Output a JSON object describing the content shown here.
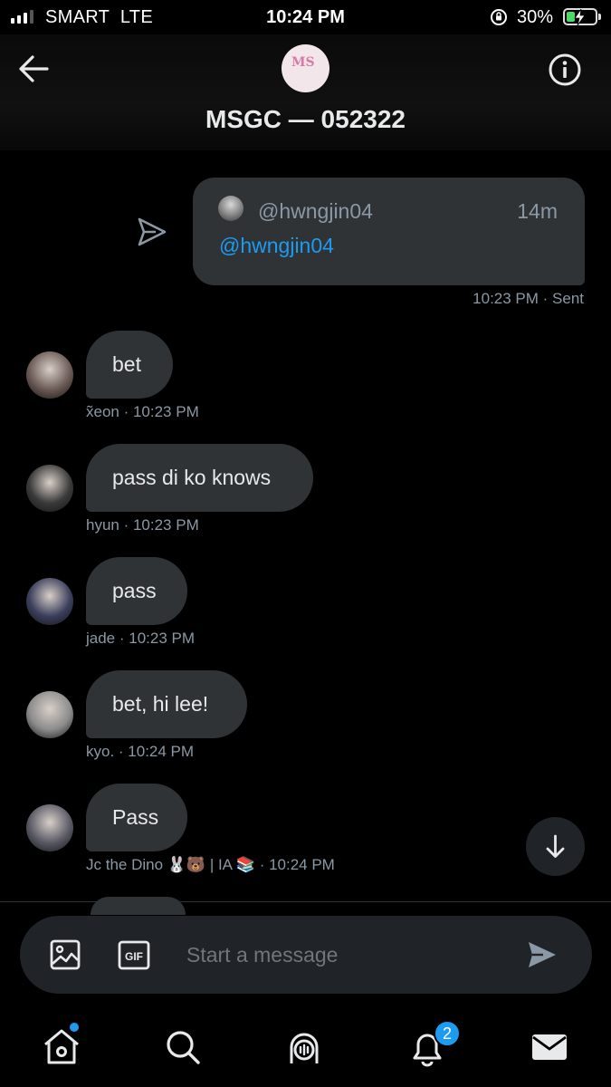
{
  "status_bar": {
    "carrier": "SMART",
    "network": "LTE",
    "time": "10:24 PM",
    "battery_percent": "30%",
    "battery_level": 0.3,
    "charging": true
  },
  "header": {
    "title": "MSGC — 052322",
    "avatar_mark": "MS",
    "back_icon": "arrow-left-icon",
    "info_icon": "info-icon"
  },
  "shared_message": {
    "author_handle": "@hwngjin04",
    "age": "14m",
    "text": "@hwngjin04",
    "time": "10:23 PM",
    "status": "Sent",
    "meta": "10:23 PM · Sent"
  },
  "messages": [
    {
      "text": "bet",
      "sender": "x̃eon",
      "time": "10:23 PM",
      "meta": "x̃eon · 10:23 PM",
      "avatar_color": "#6b5a55"
    },
    {
      "text": "pass di ko knows",
      "sender": "hyun",
      "time": "10:23 PM",
      "meta": "hyun · 10:23 PM",
      "avatar_color": "#3a3a3a"
    },
    {
      "text": "pass",
      "sender": "jade",
      "time": "10:23 PM",
      "meta": "jade · 10:23 PM",
      "avatar_color": "#3b3f5c"
    },
    {
      "text": "bet, hi lee!",
      "sender": "kyo.",
      "time": "10:24 PM",
      "meta": "kyo. · 10:24 PM",
      "avatar_color": "#8c8c8c"
    },
    {
      "text": "Pass",
      "sender": "Jc the Dino 🐰🐻 | IA 📚",
      "time": "10:24 PM",
      "meta": "Jc the Dino 🐰🐻 | IA 📚 · 10:24 PM",
      "avatar_color": "#5a5a66"
    }
  ],
  "composer": {
    "placeholder": "Start a message"
  },
  "nav": {
    "home_has_dot": true,
    "notifications_count": "2"
  },
  "colors": {
    "background": "#000000",
    "bubble": "#2f3336",
    "accent": "#1d9bf0",
    "secondary_text": "#8b98a5"
  }
}
